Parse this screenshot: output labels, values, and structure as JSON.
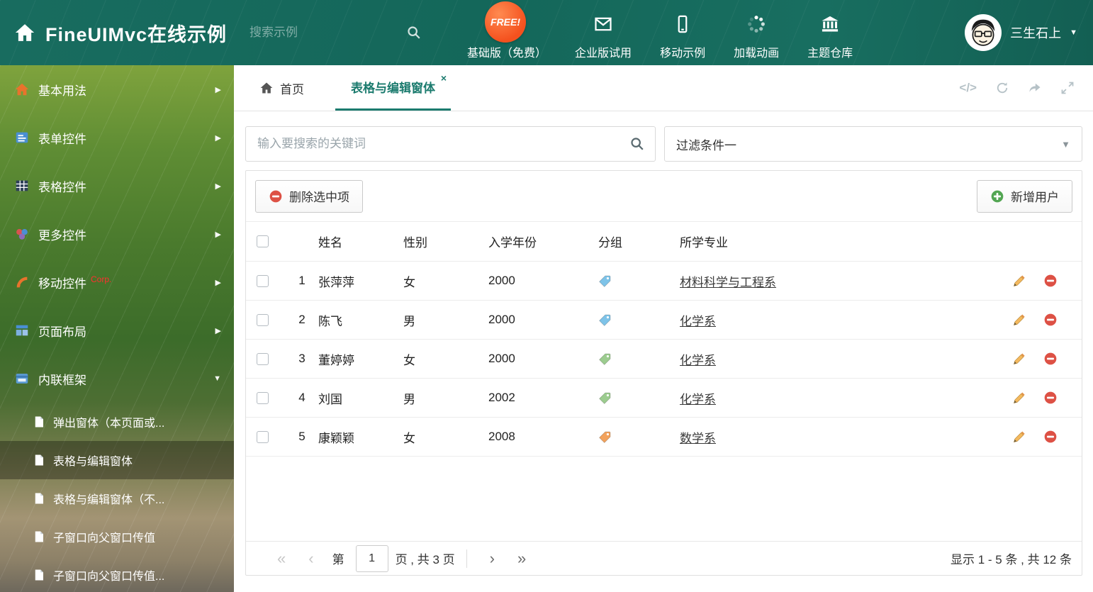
{
  "header": {
    "title": "FineUIMvc在线示例",
    "search_placeholder": "搜索示例",
    "free_badge": "FREE!",
    "nav": [
      {
        "label": "基础版（免费）"
      },
      {
        "label": "企业版试用"
      },
      {
        "label": "移动示例"
      },
      {
        "label": "加载动画"
      },
      {
        "label": "主题仓库"
      }
    ],
    "user_name": "三生石上"
  },
  "sidebar": {
    "items": [
      {
        "label": "基本用法"
      },
      {
        "label": "表单控件"
      },
      {
        "label": "表格控件"
      },
      {
        "label": "更多控件"
      },
      {
        "label": "移动控件",
        "badge": "Corp."
      },
      {
        "label": "页面布局"
      },
      {
        "label": "内联框架"
      }
    ],
    "subitems": [
      {
        "label": "弹出窗体（本页面或..."
      },
      {
        "label": "表格与编辑窗体"
      },
      {
        "label": "表格与编辑窗体（不..."
      },
      {
        "label": "子窗口向父窗口传值"
      },
      {
        "label": "子窗口向父窗口传值..."
      }
    ]
  },
  "tabs": {
    "home": "首页",
    "active": "表格与编辑窗体"
  },
  "filters": {
    "search_placeholder": "输入要搜索的关键词",
    "filter_value": "过滤条件一"
  },
  "toolbar": {
    "delete_label": "删除选中项",
    "add_label": "新增用户"
  },
  "table": {
    "headers": {
      "name": "姓名",
      "gender": "性别",
      "year": "入学年份",
      "group": "分组",
      "major": "所学专业"
    },
    "rows": [
      {
        "num": "1",
        "name": "张萍萍",
        "gender": "女",
        "year": "2000",
        "tag": "blue",
        "major": "材料科学与工程系"
      },
      {
        "num": "2",
        "name": "陈飞",
        "gender": "男",
        "year": "2000",
        "tag": "blue",
        "major": "化学系"
      },
      {
        "num": "3",
        "name": "董婷婷",
        "gender": "女",
        "year": "2000",
        "tag": "green",
        "major": "化学系"
      },
      {
        "num": "4",
        "name": "刘国",
        "gender": "男",
        "year": "2002",
        "tag": "green",
        "major": "化学系"
      },
      {
        "num": "5",
        "name": "康颖颖",
        "gender": "女",
        "year": "2008",
        "tag": "orange",
        "major": "数学系"
      }
    ]
  },
  "pagination": {
    "page_label_before": "第",
    "page_value": "1",
    "page_label_after": "页 , 共 3 页",
    "summary": "显示 1 - 5 条 , 共 12 条"
  },
  "icons": {
    "code": "</>",
    "tab_close": "×",
    "pag_first": "«",
    "pag_prev": "‹",
    "pag_next": "›",
    "pag_last": "»",
    "caret_down": "▼",
    "arrow_right": "▶"
  },
  "colors": {
    "accent": "#1b7b6e",
    "header_bg": "#14675a",
    "tag_blue": "#7ec3e8",
    "tag_green": "#9ccc8f",
    "tag_orange": "#f2a25c",
    "delete_red": "#dd5145",
    "add_green": "#53a653"
  }
}
